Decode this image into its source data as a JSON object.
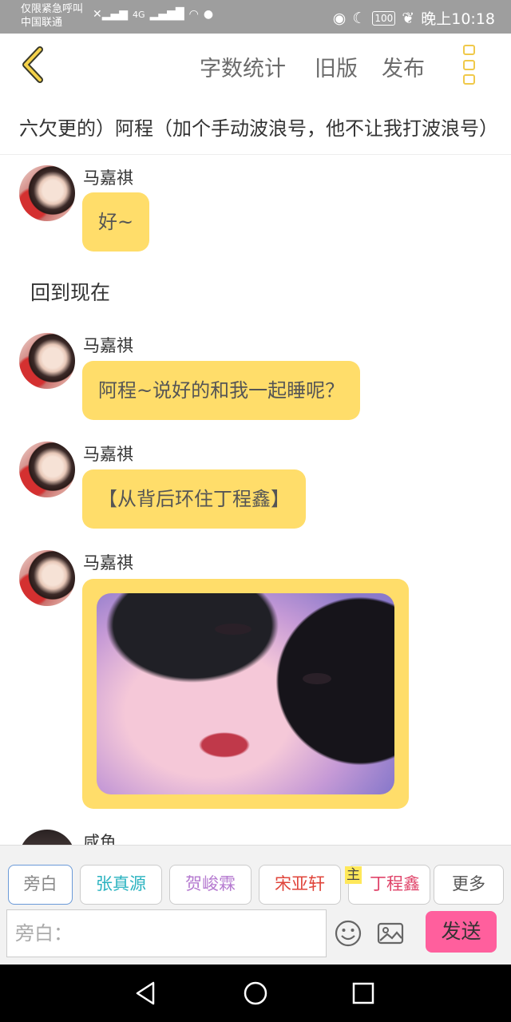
{
  "status_bar": {
    "carrier_line1": "仅限紧急呼叫",
    "carrier_line2": "中国联通",
    "network": "4G",
    "battery": "100",
    "time": "晚上10:18"
  },
  "header": {
    "word_count_label": "字数统计",
    "old_version_label": "旧版",
    "publish_label": "发布"
  },
  "story_title": "六欠更的）阿程（加个手动波浪号，他不让我打波浪号）",
  "messages": [
    {
      "sender": "马嘉祺",
      "text": "好~"
    },
    {
      "narration": "回到现在"
    },
    {
      "sender": "马嘉祺",
      "text": "阿程~说好的和我一起睡呢？"
    },
    {
      "sender": "马嘉祺",
      "text": "【从背后环住丁程鑫】"
    },
    {
      "sender": "马嘉祺",
      "image": "photo"
    },
    {
      "sender": "咸鱼"
    }
  ],
  "roles": [
    {
      "label": "旁白",
      "color": "#888888"
    },
    {
      "label": "张真源",
      "color": "#2bb3c0"
    },
    {
      "label": "贺峻霖",
      "color": "#b57ad0"
    },
    {
      "label": "宋亚轩",
      "color": "#e0443a"
    },
    {
      "label": "丁程鑫",
      "color": "#e0446a"
    },
    {
      "label": "更多",
      "color": "#555555"
    }
  ],
  "main_tag": "主",
  "input": {
    "placeholder": "旁白："
  },
  "send_label": "发送",
  "icons": {
    "emoji": "emoji-icon",
    "image": "image-icon"
  }
}
